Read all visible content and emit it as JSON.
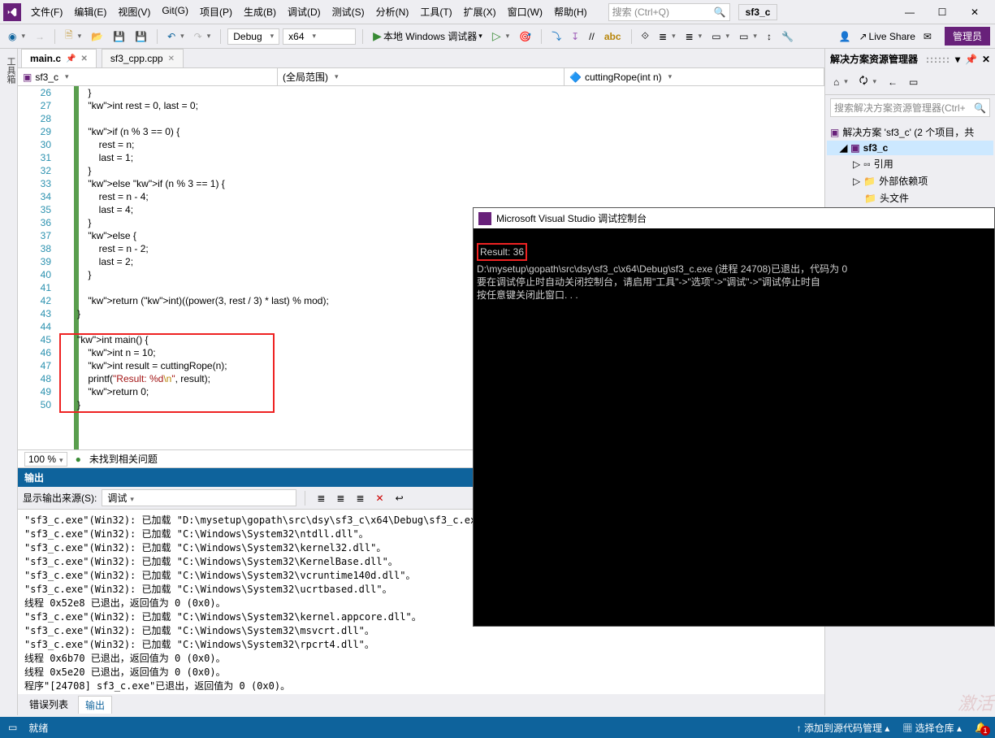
{
  "title": {
    "project": "sf3_c"
  },
  "menu": [
    "文件(F)",
    "编辑(E)",
    "视图(V)",
    "Git(G)",
    "项目(P)",
    "生成(B)",
    "调试(D)",
    "测试(S)",
    "分析(N)",
    "工具(T)",
    "扩展(X)",
    "窗口(W)",
    "帮助(H)"
  ],
  "search_placeholder": "搜索 (Ctrl+Q)",
  "toolbar": {
    "config": "Debug",
    "platform": "x64",
    "debug_btn": "本地 Windows 调试器",
    "liveshare": "Live Share",
    "admin": "管理员"
  },
  "tabs": [
    {
      "label": "main.c",
      "active": true
    },
    {
      "label": "sf3_cpp.cpp",
      "active": false
    }
  ],
  "nav": {
    "left": "sf3_c",
    "mid": "(全局范围)",
    "right": "cuttingRope(int n)"
  },
  "zoom": "100 %",
  "issues": "未找到相关问题",
  "lines": [
    26,
    27,
    28,
    29,
    30,
    31,
    32,
    33,
    34,
    35,
    36,
    37,
    38,
    39,
    40,
    41,
    42,
    43,
    44,
    45,
    46,
    47,
    48,
    49,
    50
  ],
  "code": [
    "    }",
    "    int rest = 0, last = 0;",
    "",
    "    if (n % 3 == 0) {",
    "        rest = n;",
    "        last = 1;",
    "    }",
    "    else if (n % 3 == 1) {",
    "        rest = n - 4;",
    "        last = 4;",
    "    }",
    "    else {",
    "        rest = n - 2;",
    "        last = 2;",
    "    }",
    "",
    "    return (int)((power(3, rest / 3) * last) % mod);",
    "}",
    "",
    "int main() {",
    "    int n = 10;",
    "    int result = cuttingRope(n);",
    "    printf(\"Result: %d\\n\", result);",
    "    return 0;",
    "}"
  ],
  "output": {
    "title": "输出",
    "src_label": "显示输出来源(S):",
    "src_value": "调试",
    "bottom_tabs": [
      "错误列表",
      "输出"
    ],
    "text": "\"sf3_c.exe\"(Win32): 已加载 \"D:\\mysetup\\gopath\\src\\dsy\\sf3_c\\x64\\Debug\\sf3_c.exe\"。已加\n\"sf3_c.exe\"(Win32): 已加载 \"C:\\Windows\\System32\\ntdll.dll\"。\n\"sf3_c.exe\"(Win32): 已加载 \"C:\\Windows\\System32\\kernel32.dll\"。\n\"sf3_c.exe\"(Win32): 已加载 \"C:\\Windows\\System32\\KernelBase.dll\"。\n\"sf3_c.exe\"(Win32): 已加载 \"C:\\Windows\\System32\\vcruntime140d.dll\"。\n\"sf3_c.exe\"(Win32): 已加载 \"C:\\Windows\\System32\\ucrtbased.dll\"。\n线程 0x52e8 已退出，返回值为 0 (0x0)。\n\"sf3_c.exe\"(Win32): 已加载 \"C:\\Windows\\System32\\kernel.appcore.dll\"。\n\"sf3_c.exe\"(Win32): 已加载 \"C:\\Windows\\System32\\msvcrt.dll\"。\n\"sf3_c.exe\"(Win32): 已加载 \"C:\\Windows\\System32\\rpcrt4.dll\"。\n线程 0x6b70 已退出，返回值为 0 (0x0)。\n线程 0x5e20 已退出，返回值为 0 (0x0)。\n程序\"[24708] sf3_c.exe\"已退出，返回值为 0 (0x0)。\n"
  },
  "solution": {
    "title": "解决方案资源管理器",
    "search": "搜索解决方案资源管理器(Ctrl+",
    "root": "解决方案 'sf3_c' (2 个项目，共",
    "items": [
      "sf3_c",
      "引用",
      "外部依赖项",
      "头文件"
    ]
  },
  "console": {
    "title": "Microsoft Visual Studio 调试控制台",
    "result": "Result: 36",
    "body": "\nD:\\mysetup\\gopath\\src\\dsy\\sf3_c\\x64\\Debug\\sf3_c.exe (进程 24708)已退出，代码为 0\n要在调试停止时自动关闭控制台，请启用\"工具\"->\"选项\"->\"调试\"->\"调试停止时自\n按任意键关闭此窗口. . .\n"
  },
  "statusbar": {
    "ready": "就绪",
    "src": "添加到源代码管理",
    "repo": "选择仓库"
  }
}
